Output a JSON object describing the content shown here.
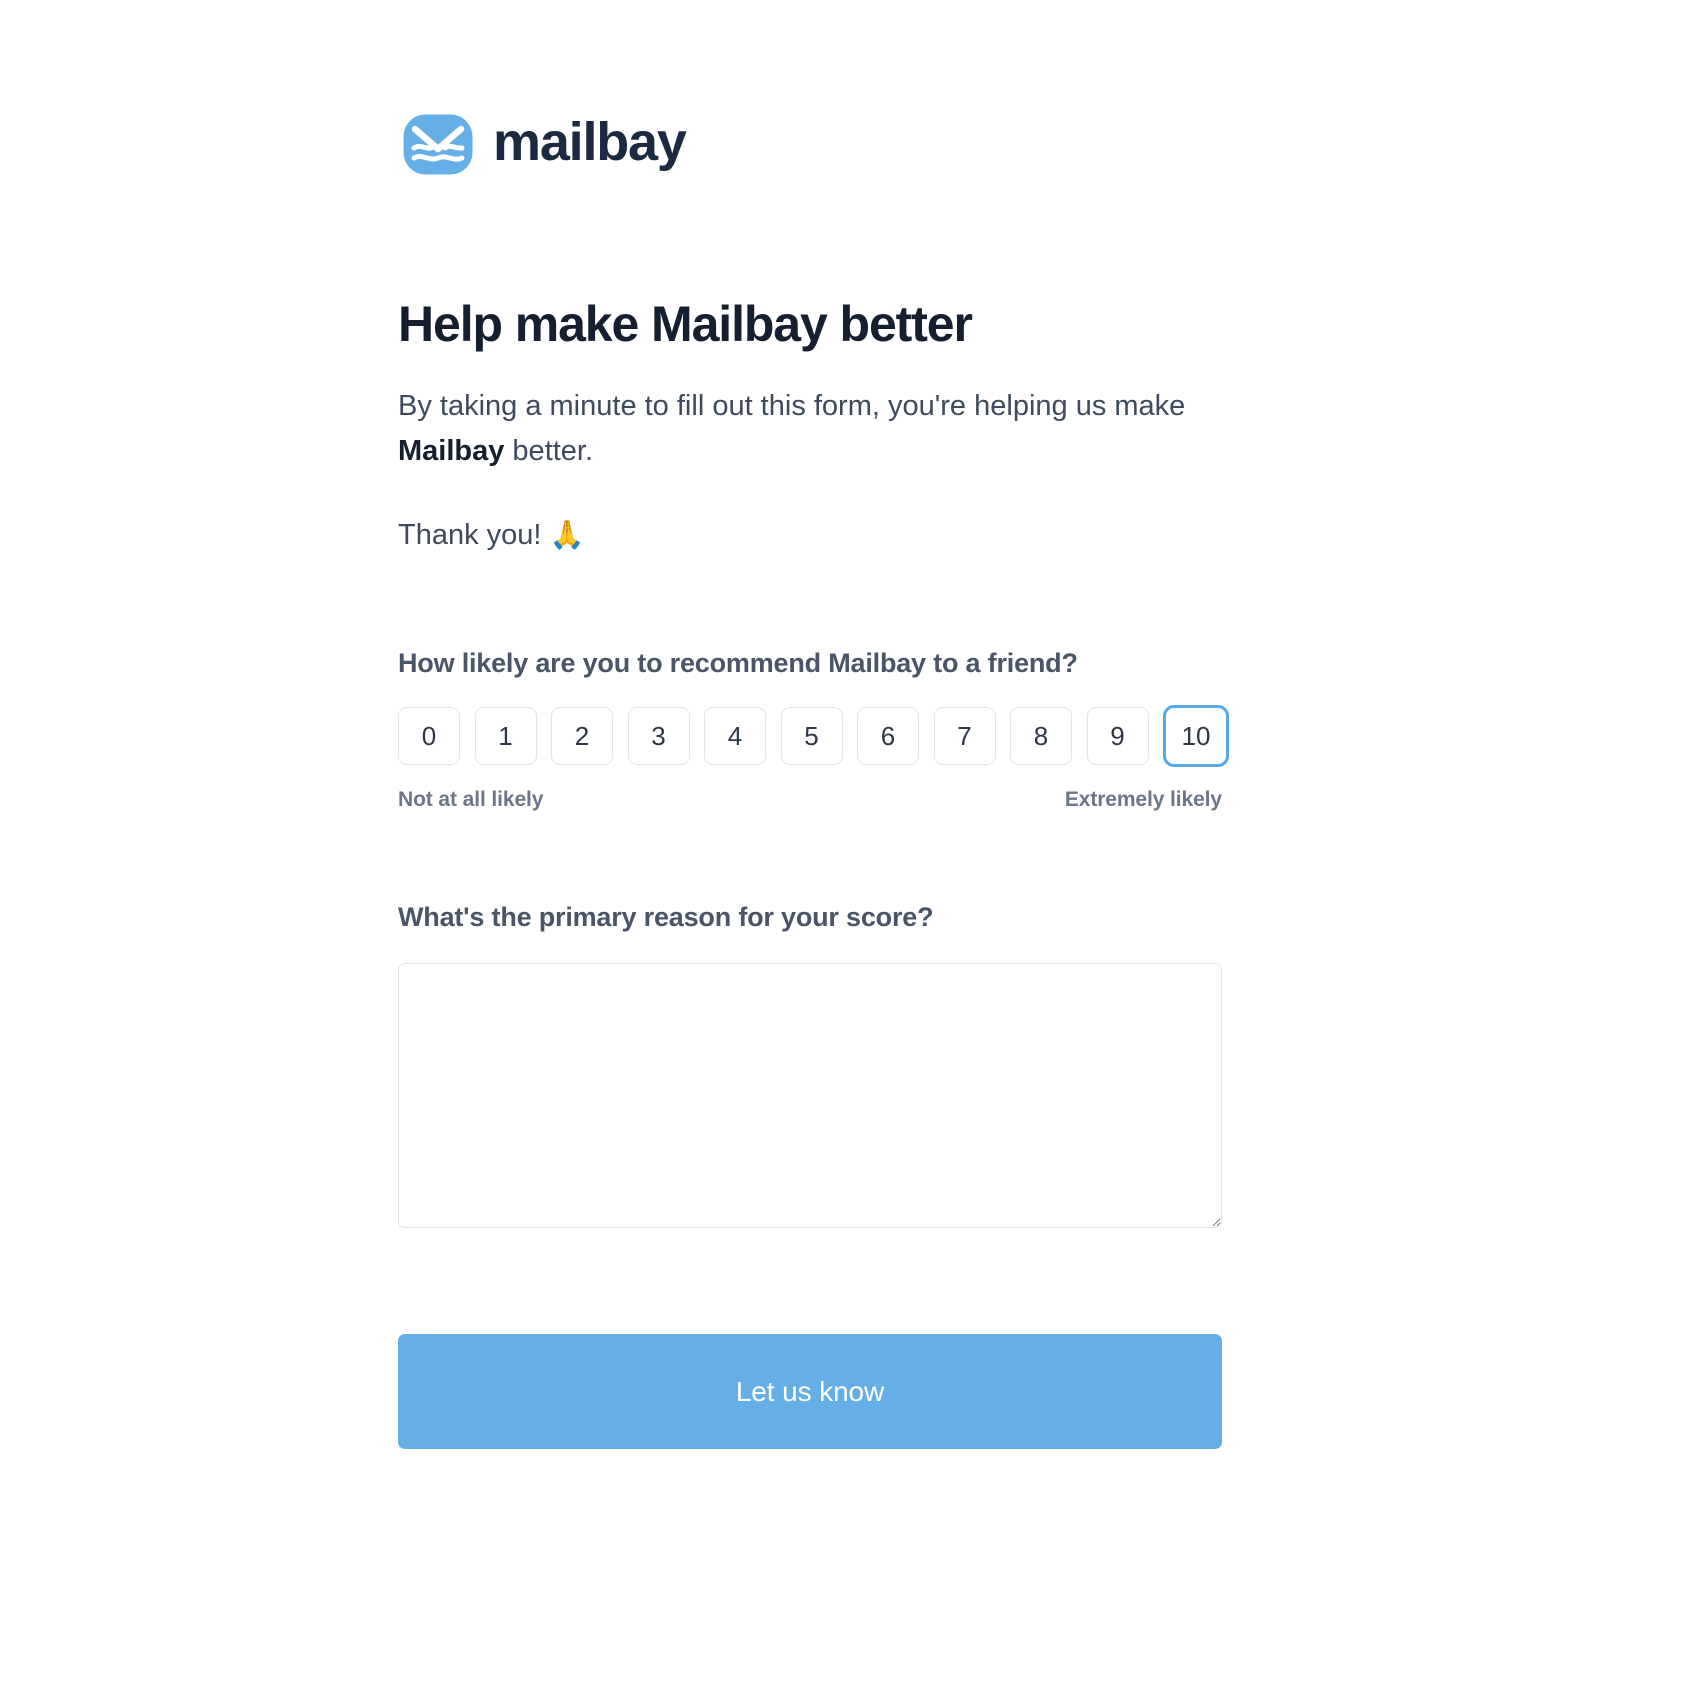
{
  "brand": {
    "name": "mailbay",
    "logo_icon": "envelope-wave-icon",
    "accent_color": "#65afe6",
    "wordmark_color": "#1b2a41"
  },
  "headline": "Help make Mailbay better",
  "intro": {
    "before": "By taking a minute to fill out this form, you're helping us make ",
    "emphasis": "Mailbay",
    "after": " better."
  },
  "thanks": {
    "text": "Thank you! ",
    "emoji": "🙏"
  },
  "nps": {
    "question": "How likely are you to recommend Mailbay to a friend?",
    "options": [
      "0",
      "1",
      "2",
      "3",
      "4",
      "5",
      "6",
      "7",
      "8",
      "9",
      "10"
    ],
    "selected": "10",
    "legend_low": "Not at all likely",
    "legend_high": "Extremely likely"
  },
  "reason": {
    "question": "What's the primary reason for your score?",
    "value": "",
    "placeholder": ""
  },
  "submit": {
    "label": "Let us know"
  }
}
